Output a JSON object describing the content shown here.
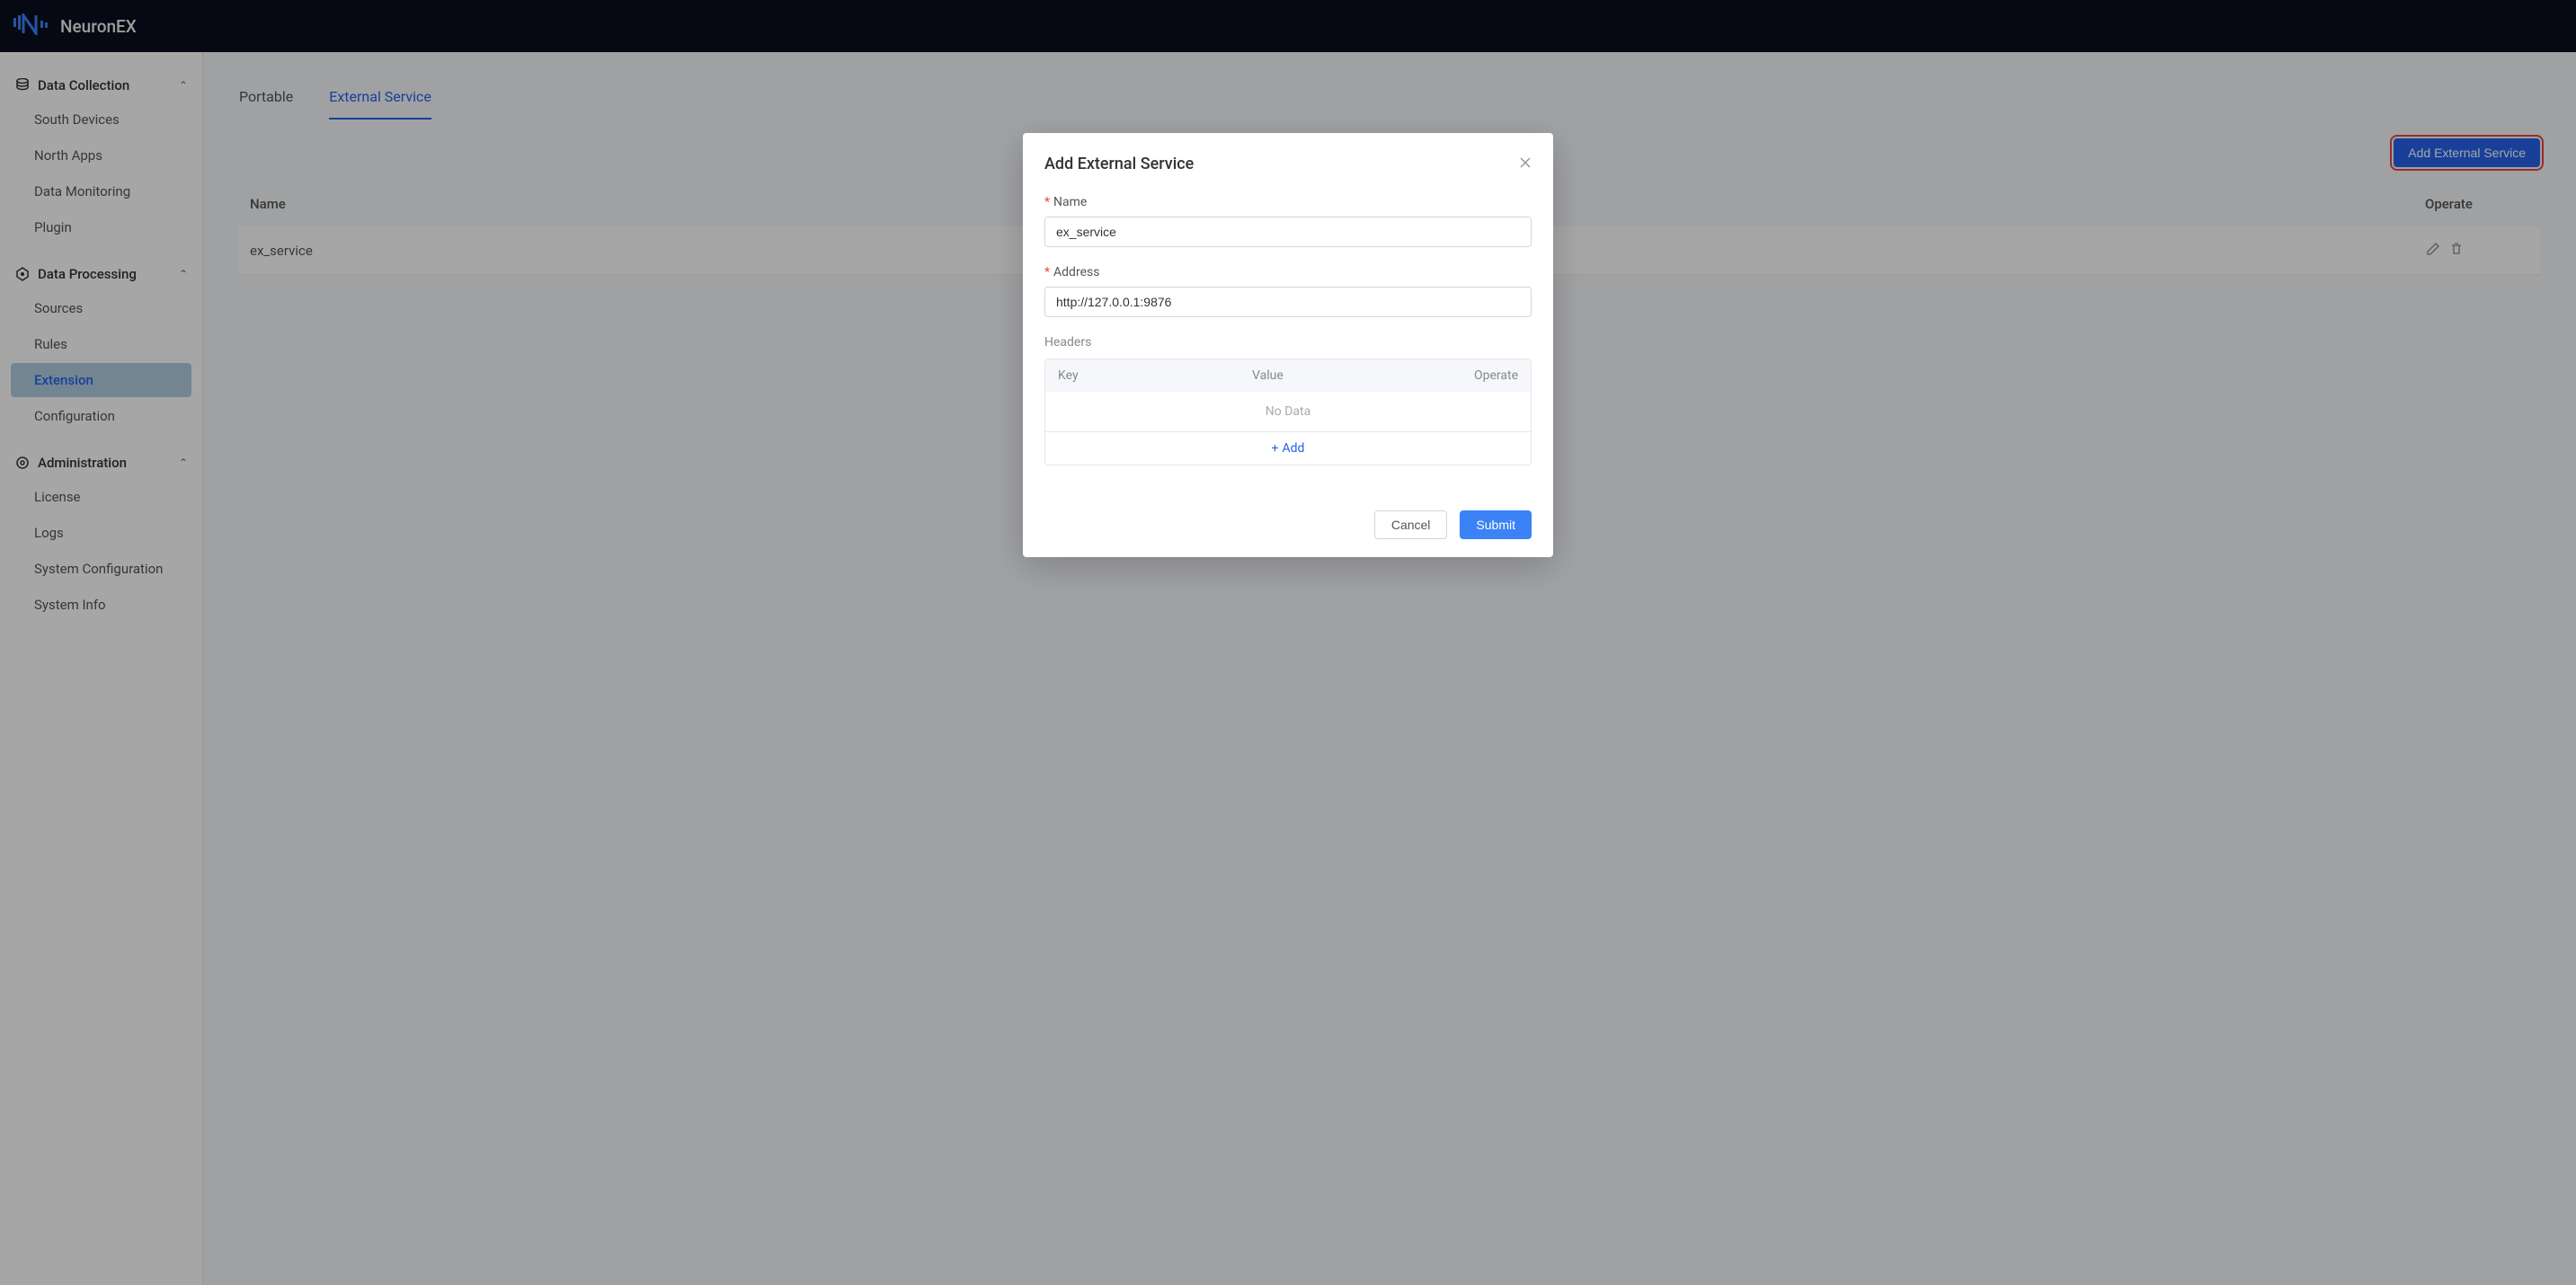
{
  "header": {
    "brand": "NeuronEX"
  },
  "sidebar": {
    "groups": [
      {
        "label": "Data Collection",
        "items": [
          "South Devices",
          "North Apps",
          "Data Monitoring",
          "Plugin"
        ]
      },
      {
        "label": "Data Processing",
        "items": [
          "Sources",
          "Rules",
          "Extension",
          "Configuration"
        ]
      },
      {
        "label": "Administration",
        "items": [
          "License",
          "Logs",
          "System Configuration",
          "System Info"
        ]
      }
    ],
    "active": "Extension"
  },
  "tabs": {
    "items": [
      "Portable",
      "External Service"
    ],
    "active": "External Service"
  },
  "actions": {
    "add_external_service": "Add External Service"
  },
  "table": {
    "columns": {
      "name": "Name",
      "operate": "Operate"
    },
    "rows": [
      {
        "name": "ex_service"
      }
    ]
  },
  "dialog": {
    "title": "Add External Service",
    "fields": {
      "name": {
        "label": "Name",
        "value": "ex_service",
        "required": true
      },
      "address": {
        "label": "Address",
        "value": "http://127.0.0.1:9876",
        "required": true
      }
    },
    "headers": {
      "label": "Headers",
      "columns": {
        "key": "Key",
        "value": "Value",
        "operate": "Operate"
      },
      "empty_text": "No Data",
      "add_label": "Add"
    },
    "buttons": {
      "cancel": "Cancel",
      "submit": "Submit"
    }
  }
}
